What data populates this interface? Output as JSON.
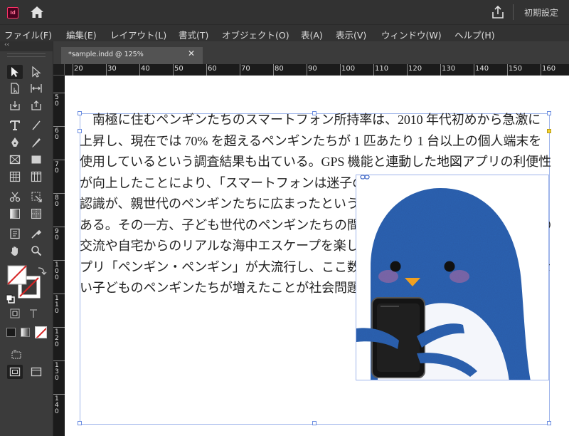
{
  "app": {
    "logo_text": "Id",
    "workspace_label": "初期設定"
  },
  "menu": [
    "ファイル(F)",
    "編集(E)",
    "レイアウト(L)",
    "書式(T)",
    "オブジェクト(O)",
    "表(A)",
    "表示(V)",
    "ウィンドウ(W)",
    "ヘルプ(H)"
  ],
  "toolbar": {
    "collapse_label": "‹‹"
  },
  "document": {
    "tab_title": "*sample.indd @ 125%",
    "close_label": "✕"
  },
  "rulers": {
    "h_labels": [
      "20",
      "30",
      "40",
      "50",
      "60",
      "70",
      "80",
      "90",
      "100",
      "110",
      "120",
      "130",
      "140",
      "150",
      "160"
    ],
    "v_labels": [
      "50",
      "60",
      "70",
      "80",
      "90",
      "100",
      "110",
      "120",
      "130",
      "140"
    ]
  },
  "body_text": "　南極に住むペンギンたちのスマートフォン所持率は、2010 年代初めから急激に上昇し、現在では 70% を超えるペンギンたちが 1 匹あたり 1 台以上の個人端末を使用しているという調査結果も出ている。GPS 機能と連動した地図アプリの利便性が向上したことにより、「スマートフォンは迷子のペンギン捜索に役立つ」という認識が、親世代のペンギンたちに広まったということも大きく影響しているようである。その一方、子ども世代のペンギンたちの間では、SNS でつながった仲間との交流や自宅からのリアルな海中エスケープを楽しめるスマートフォン向けゲームアプリ「ペンギン・ペンギン」が大流行し、ここ数年間で海に飛び込むことのできない子どものペンギンたちが増えたことが社会問題化している。",
  "colors": {
    "frame_border": "#9fb5ea",
    "penguin_blue": "#2f63b4",
    "beak": "#f0a020"
  }
}
